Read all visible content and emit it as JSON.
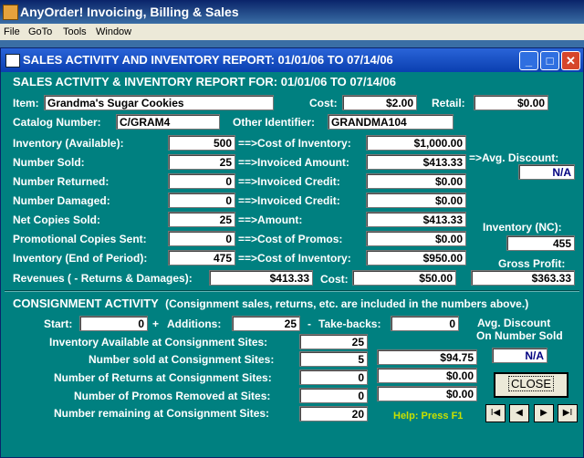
{
  "app": {
    "title": "AnyOrder! Invoicing, Billing & Sales"
  },
  "menu": [
    "File",
    "GoTo",
    "Tools",
    "Window"
  ],
  "window": {
    "title": "SALES ACTIVITY AND INVENTORY REPORT:  01/01/06 TO 07/14/06"
  },
  "report": {
    "heading": "SALES ACTIVITY & INVENTORY REPORT FOR: 01/01/06 TO 07/14/06",
    "item_label": "Item:",
    "item_value": "Grandma's  Sugar Cookies",
    "cost_label": "Cost:",
    "cost_value": "$2.00",
    "retail_label": "Retail:",
    "retail_value": "$0.00",
    "catalog_label": "Catalog Number:",
    "catalog_value": "C/GRAM4",
    "other_label": "Other Identifier:",
    "other_value": "GRANDMA104",
    "rows": [
      {
        "label": "Inventory (Available):",
        "qty": "500",
        "arrow": "==>Cost of Inventory:",
        "amount": "$1,000.00"
      },
      {
        "label": "Number Sold:",
        "qty": "25",
        "arrow": "==>Invoiced Amount:",
        "amount": "$413.33"
      },
      {
        "label": "Number Returned:",
        "qty": "0",
        "arrow": "==>Invoiced Credit:",
        "amount": "$0.00"
      },
      {
        "label": "Number Damaged:",
        "qty": "0",
        "arrow": "==>Invoiced Credit:",
        "amount": "$0.00"
      },
      {
        "label": "Net Copies Sold:",
        "qty": "25",
        "arrow": "==>Amount:",
        "amount": "$413.33"
      },
      {
        "label": "Promotional Copies Sent:",
        "qty": "0",
        "arrow": "==>Cost of Promos:",
        "amount": "$0.00"
      },
      {
        "label": "Inventory (End of Period):",
        "qty": "475",
        "arrow": "==>Cost of Inventory:",
        "amount": "$950.00"
      }
    ],
    "avg_discount_label": "=>Avg. Discount:",
    "avg_discount_value": "N/A",
    "inventory_nc_label": "Inventory (NC):",
    "inventory_nc_value": "455",
    "revenues_label": "Revenues ( - Returns & Damages):",
    "revenues_value": "$413.33",
    "rev_cost_label": "Cost:",
    "rev_cost_value": "$50.00",
    "gross_profit_label": "Gross Profit:",
    "gross_profit_value": "$363.33"
  },
  "consign": {
    "heading": "CONSIGNMENT ACTIVITY",
    "note": "(Consignment sales, returns, etc. are included in the numbers above.)",
    "start_label": "Start:",
    "start_value": "0",
    "plus": "+",
    "additions_label": "Additions:",
    "additions_value": "25",
    "minus": "-",
    "takebacks_label": "Take-backs:",
    "takebacks_value": "0",
    "avg_label_1": "Avg. Discount",
    "avg_label_2": "On Number Sold",
    "avg_value": "N/A",
    "rows": [
      {
        "label": "Inventory Available at Consignment Sites:",
        "qty": "25",
        "amount": null
      },
      {
        "label": "Number sold at Consignment Sites:",
        "qty": "5",
        "amount": "$94.75"
      },
      {
        "label": "Number of Returns at Consignment Sites:",
        "qty": "0",
        "amount": "$0.00"
      },
      {
        "label": "Number of Promos Removed at Sites:",
        "qty": "0",
        "amount": "$0.00"
      },
      {
        "label": "Number remaining at Consignment Sites:",
        "qty": "20",
        "amount": null
      }
    ],
    "help": "Help:  Press F1",
    "close_label": "CLOSE"
  },
  "nav": {
    "first": "I◀",
    "prev": "◀",
    "next": "▶",
    "last": "▶I"
  }
}
